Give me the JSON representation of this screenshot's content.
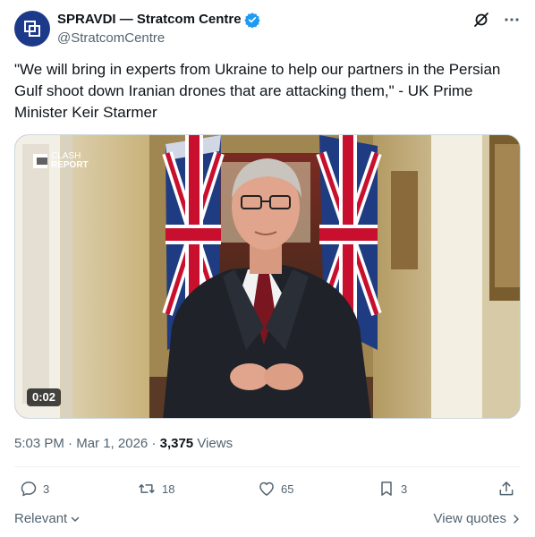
{
  "author": {
    "display_name": "SPRAVDI — Stratcom Centre",
    "handle": "@StratcomCentre"
  },
  "icons": {
    "avatar": "spravdi-logo",
    "verified": "verified-badge-icon",
    "grok": "grok-icon",
    "more": "more-options-icon",
    "reply": "reply-icon",
    "repost": "repost-icon",
    "like": "like-icon",
    "bookmark": "bookmark-icon",
    "share": "share-icon"
  },
  "colors": {
    "verified": "#1d9bf0",
    "text_primary": "#0f1419",
    "text_secondary": "#536471",
    "avatar_bg": "#1d3a8a"
  },
  "tweet": {
    "text": "\"We will bring in experts from Ukraine to help our partners in the Persian Gulf shoot down Iranian drones that are attacking them,\" - UK Prime Minister Keir Starmer"
  },
  "media": {
    "watermark_line1": "CLASH",
    "watermark_line2": "REPORT",
    "duration": "0:02"
  },
  "meta": {
    "time": "5:03 PM",
    "date": "Mar 1, 2026",
    "views_count": "3,375",
    "views_label": "Views"
  },
  "actions": {
    "replies": "3",
    "reposts": "18",
    "likes": "65",
    "bookmarks": "3"
  },
  "footer": {
    "sort_label": "Relevant",
    "view_quotes": "View quotes"
  }
}
